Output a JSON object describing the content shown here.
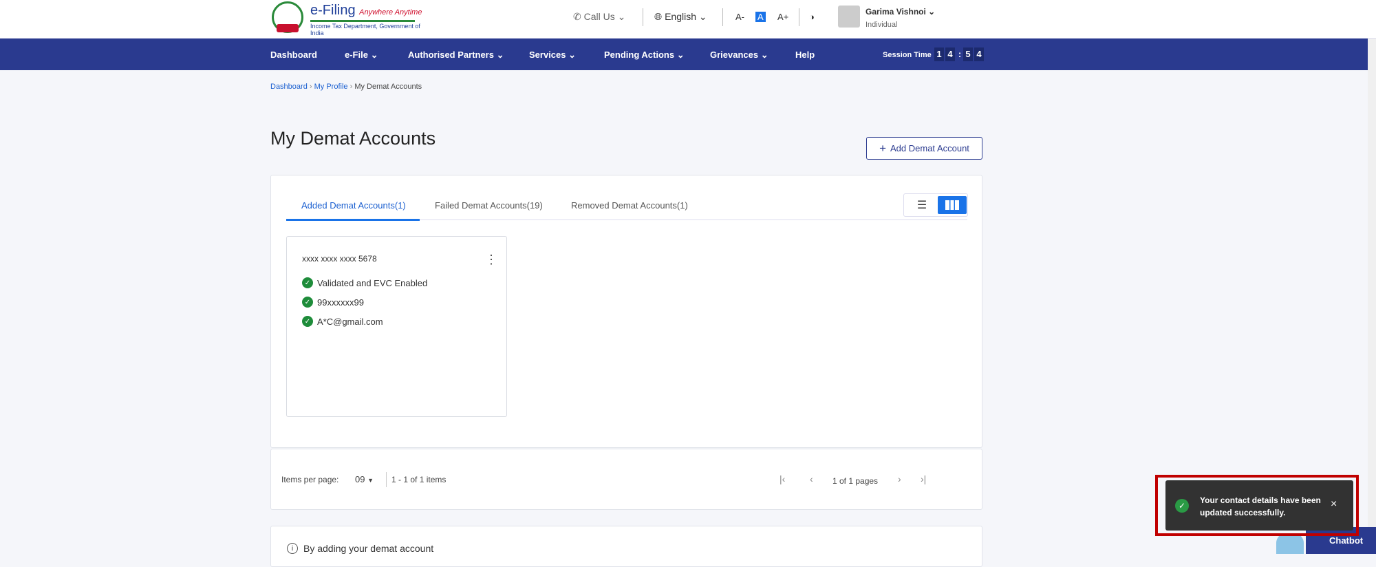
{
  "header": {
    "logo": {
      "title": "e-Filing",
      "tagline": "Anywhere Anytime",
      "subtitle": "Income Tax Department, Government of India"
    },
    "call_us": "Call Us",
    "language": "English",
    "font_small": "A-",
    "font_normal": "A",
    "font_large": "A+",
    "user": {
      "name": "Garima Vishnoi",
      "role": "Individual"
    }
  },
  "nav": {
    "items": [
      "Dashboard",
      "e-File",
      "Authorised Partners",
      "Services",
      "Pending Actions",
      "Grievances",
      "Help"
    ],
    "session_label": "Session Time",
    "session_digits": [
      "1",
      "4",
      ":",
      "5",
      "4"
    ]
  },
  "breadcrumb": [
    "Dashboard",
    "My Profile",
    "My Demat Accounts"
  ],
  "page": {
    "title": "My Demat Accounts",
    "add_button": "Add Demat Account"
  },
  "tabs": [
    "Added Demat Accounts(1)",
    "Failed Demat Accounts(19)",
    "Removed Demat Accounts(1)"
  ],
  "card": {
    "account": "xxxx xxxx xxxx 5678",
    "lines": [
      "Validated and EVC Enabled",
      "99xxxxxx99",
      "A*C@gmail.com"
    ]
  },
  "pagination": {
    "items_label": "Items per page:",
    "per_page": "09",
    "range": "1 - 1 of 1 items",
    "pages": "1 of 1 pages"
  },
  "info": {
    "text": "By adding your demat account"
  },
  "toast": {
    "message": "Your contact details have been updated successfully.",
    "close": "×"
  },
  "chatbot": "Chatbot"
}
